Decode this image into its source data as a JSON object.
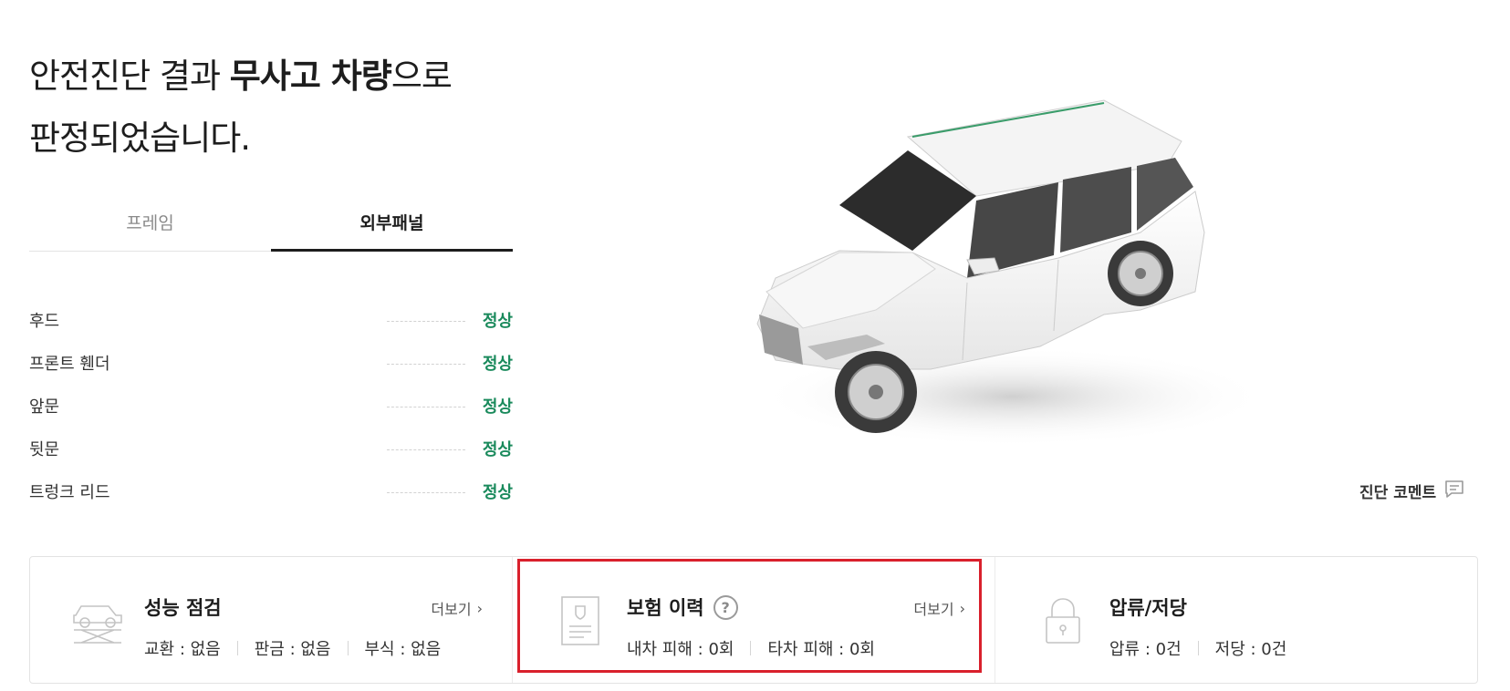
{
  "headline": {
    "line1_prefix": "안전진단 결과 ",
    "line1_bold": "무사고 차량",
    "line1_suffix": "으로",
    "line2": "판정되었습니다."
  },
  "tabs": [
    {
      "label": "프레임",
      "active": false
    },
    {
      "label": "외부패널",
      "active": true
    }
  ],
  "parts": [
    {
      "name": "후드",
      "status": "정상"
    },
    {
      "name": "프론트 휀더",
      "status": "정상"
    },
    {
      "name": "앞문",
      "status": "정상"
    },
    {
      "name": "뒷문",
      "status": "정상"
    },
    {
      "name": "트렁크 리드",
      "status": "정상"
    }
  ],
  "comment_button": {
    "label": "진단 코멘트",
    "icon": "comment-icon"
  },
  "cards": {
    "performance": {
      "title": "성능 점검",
      "more": "더보기",
      "icon": "car-lift-icon",
      "stats": [
        "교환 : 없음",
        "판금 : 없음",
        "부식 : 없음"
      ]
    },
    "insurance": {
      "title": "보험 이력",
      "more": "더보기",
      "icon": "document-icon",
      "help": "?",
      "stats": [
        "내차 피해 : 0회",
        "타차 피해 : 0회"
      ]
    },
    "lien": {
      "title": "압류/저당",
      "icon": "lock-icon",
      "stats": [
        "압류 : 0건",
        "저당 : 0건"
      ]
    }
  },
  "colors": {
    "status_ok": "#1a8a5c",
    "highlight": "#d9202c",
    "text_dark": "#1d1d1d"
  }
}
